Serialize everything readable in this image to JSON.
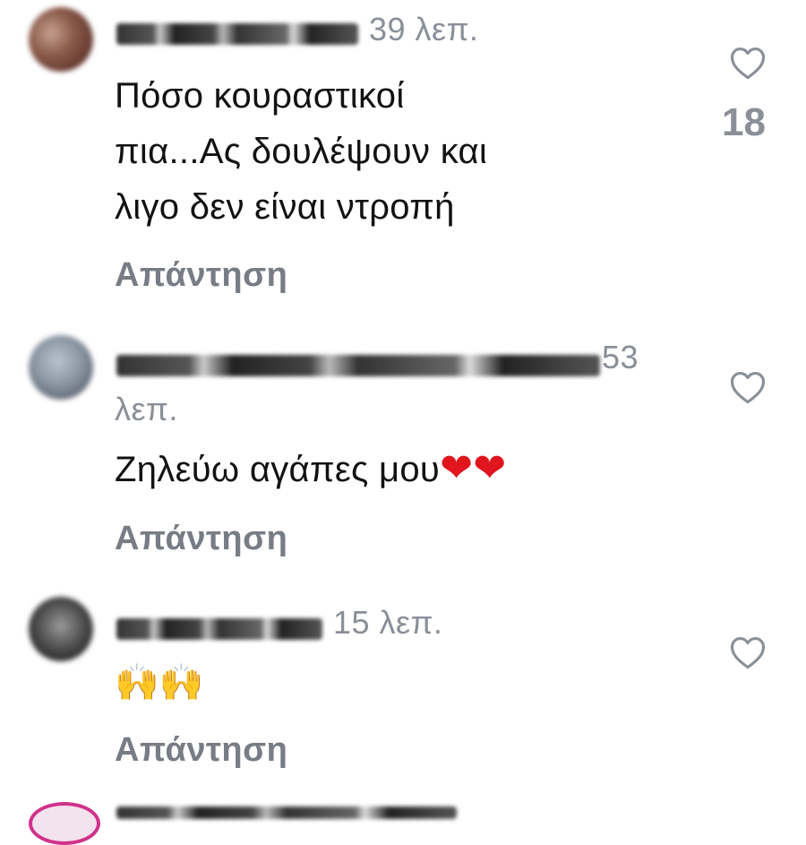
{
  "comments": [
    {
      "time": "39 λεπ.",
      "text_lines": [
        "Πόσο κουραστικοί",
        "πια...Ας δουλέψουν και",
        "λιγο δεν είναι ντροπή"
      ],
      "reply_label": "Απάντηση",
      "likes": "18"
    },
    {
      "time_part1": "53",
      "time_part2": "λεπ.",
      "text": "Ζηλεύω αγάπες μου",
      "emoji": "❤❤",
      "reply_label": "Απάντηση"
    },
    {
      "time": "15 λεπ.",
      "emoji": "🙌🙌",
      "reply_label": "Απάντηση"
    }
  ],
  "icons": {
    "like": "heart-outline-icon"
  },
  "colors": {
    "text": "#121212",
    "muted": "#8a8f98",
    "reply": "#777c85",
    "heart_red": "#e0151d"
  }
}
